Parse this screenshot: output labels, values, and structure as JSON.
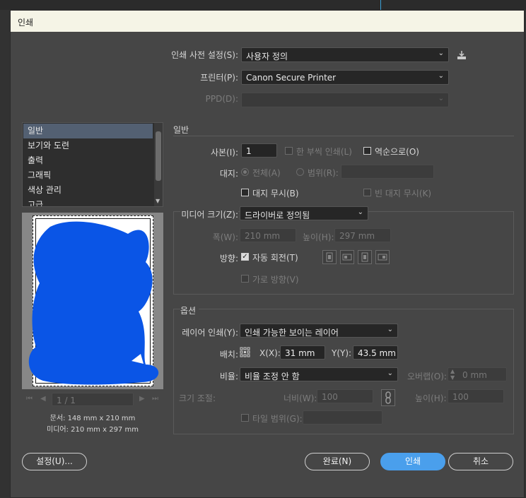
{
  "dialog": {
    "title": "인쇄"
  },
  "preset": {
    "label": "인쇄 사전 설정(S):",
    "value": "사용자 정의"
  },
  "printer": {
    "label": "프린터(P):",
    "value": "Canon Secure Printer"
  },
  "ppd": {
    "label": "PPD(D):",
    "value": ""
  },
  "categories": [
    {
      "label": "일반"
    },
    {
      "label": "보기와 도련"
    },
    {
      "label": "출력"
    },
    {
      "label": "그래픽"
    },
    {
      "label": "색상 관리"
    },
    {
      "label": "고급"
    }
  ],
  "general": {
    "section_title": "일반",
    "copies_label": "사본(I):",
    "copies_value": "1",
    "collate_label": "한 부씩 인쇄(L)",
    "reverse_label": "역순으로(O)",
    "pages_label": "대지:",
    "all_label": "전체(A)",
    "range_label": "범위(R):",
    "ignore_bleed_label": "대지 무시(B)",
    "blank_label": "빈 대지 무시(K)"
  },
  "media": {
    "size_label": "미디어 크기(Z):",
    "size_value": "드라이버로 정의됨",
    "width_label": "폭(W):",
    "width_value": "210 mm",
    "height_label": "높이(H):",
    "height_value": "297 mm",
    "orient_label": "방향:",
    "auto_rotate_label": "자동 회전(T)",
    "landscape_label": "가로 방향(V)"
  },
  "options": {
    "section_title": "옵션",
    "layers_label": "레이어 인쇄(Y):",
    "layers_value": "인쇄 가능한 보이는 레이어",
    "placement_label": "배치:",
    "x_label": "X(X):",
    "x_value": "31 mm",
    "y_label": "Y(Y):",
    "y_value": "43.5 mm",
    "scale_label": "비율:",
    "scale_value": "비율 조정 안 함",
    "overlap_label": "오버랩(O):",
    "overlap_value": "0 mm",
    "fit_label": "크기 조절:",
    "fit_w_label": "너비(W):",
    "fit_w_value": "100",
    "fit_h_label": "높이(H):",
    "fit_h_value": "100",
    "tile_label": "타일 범위(G):"
  },
  "preview": {
    "page_counter": "1 / 1",
    "doc_size": "문서: 148 mm x 210 mm",
    "media_size": "미디어: 210 mm x 297 mm"
  },
  "buttons": {
    "setup": "설정(U)...",
    "done": "완료(N)",
    "print": "인쇄",
    "cancel": "취소"
  },
  "colors": {
    "accent": "#4a9fec",
    "selection": "#536072",
    "redaction": "#0a55e6"
  }
}
